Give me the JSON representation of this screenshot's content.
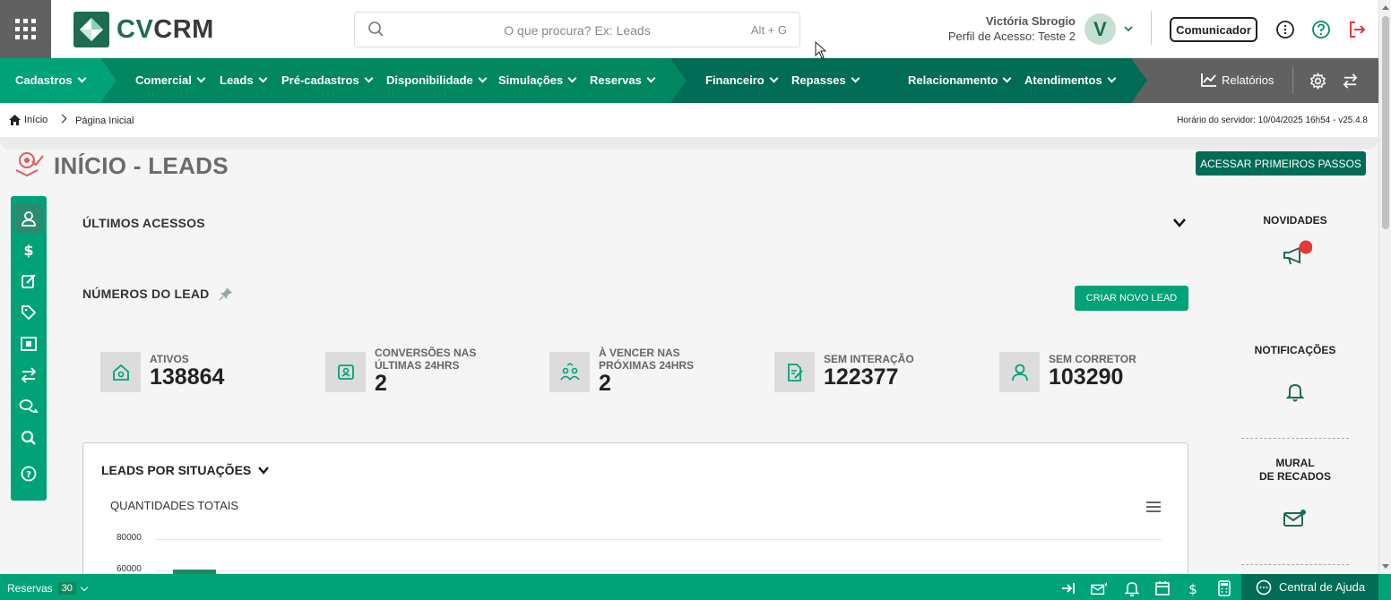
{
  "header": {
    "logo_text_prefix": "CV",
    "logo_text_suffix": "CRM",
    "search_placeholder": "O que procura? Ex: Leads",
    "search_shortcut": "Alt + G",
    "user_name": "Victória Sbrogio",
    "user_profile": "Perfil de Acesso: Teste 2",
    "avatar_initial": "V",
    "communicator_label": "Comunicador"
  },
  "nav": {
    "items": [
      {
        "label": "Cadastros"
      },
      {
        "label": "Comercial"
      },
      {
        "label": "Leads"
      },
      {
        "label": "Pré-cadastros"
      },
      {
        "label": "Disponibilidade"
      },
      {
        "label": "Simulações"
      },
      {
        "label": "Reservas"
      },
      {
        "label": "Financeiro"
      },
      {
        "label": "Repasses"
      },
      {
        "label": "Relacionamento"
      },
      {
        "label": "Atendimentos"
      }
    ],
    "reports_label": "Relatórios",
    "colors": {
      "primary": "#00a277",
      "mid": "#00875f",
      "dark": "#006c55",
      "gray": "#616161"
    }
  },
  "breadcrumb": {
    "home": "Início",
    "current": "Página Inicial",
    "server_time": "Horário do servidor: 10/04/2025 16h54 - v25.4.8"
  },
  "page": {
    "title": "INÍCIO - LEADS",
    "primary_button": "ACESSAR PRIMEIROS PASSOS",
    "last_access": "ÚLTIMOS ACESSOS",
    "lead_numbers": "NÚMEROS DO LEAD",
    "new_lead_button": "CRIAR NOVO LEAD"
  },
  "stats": [
    {
      "label1": "ATIVOS",
      "label2": "",
      "value": "138864",
      "icon": "home-icon"
    },
    {
      "label1": "CONVERSÕES NAS",
      "label2": "ÚLTIMAS 24HRS",
      "value": "2",
      "icon": "user-badge-icon"
    },
    {
      "label1": "À VENCER NAS",
      "label2": "PRÓXIMAS 24HRS",
      "value": "2",
      "icon": "users-icon"
    },
    {
      "label1": "SEM INTERAÇÃO",
      "label2": "",
      "value": "122377",
      "icon": "document-edit-icon"
    },
    {
      "label1": "SEM CORRETOR",
      "label2": "",
      "value": "103290",
      "icon": "person-icon"
    }
  ],
  "chart": {
    "title": "LEADS POR SITUAÇÕES",
    "subtitle": "QUANTIDADES TOTAIS",
    "ticks": [
      "80000",
      "60000"
    ]
  },
  "chart_data": {
    "type": "bar",
    "title": "QUANTIDADES TOTAIS",
    "ylabel": "",
    "xlabel": "",
    "y_ticks": [
      80000,
      60000
    ],
    "categories": [],
    "values": []
  },
  "right_panel": {
    "news": "NOVIDADES",
    "notifications": "NOTIFICAÇÕES",
    "board_line1": "MURAL",
    "board_line2": "DE RECADOS"
  },
  "footer": {
    "reservations_label": "Reservas",
    "reservations_count": "30",
    "help_label": "Central de Ajuda"
  }
}
